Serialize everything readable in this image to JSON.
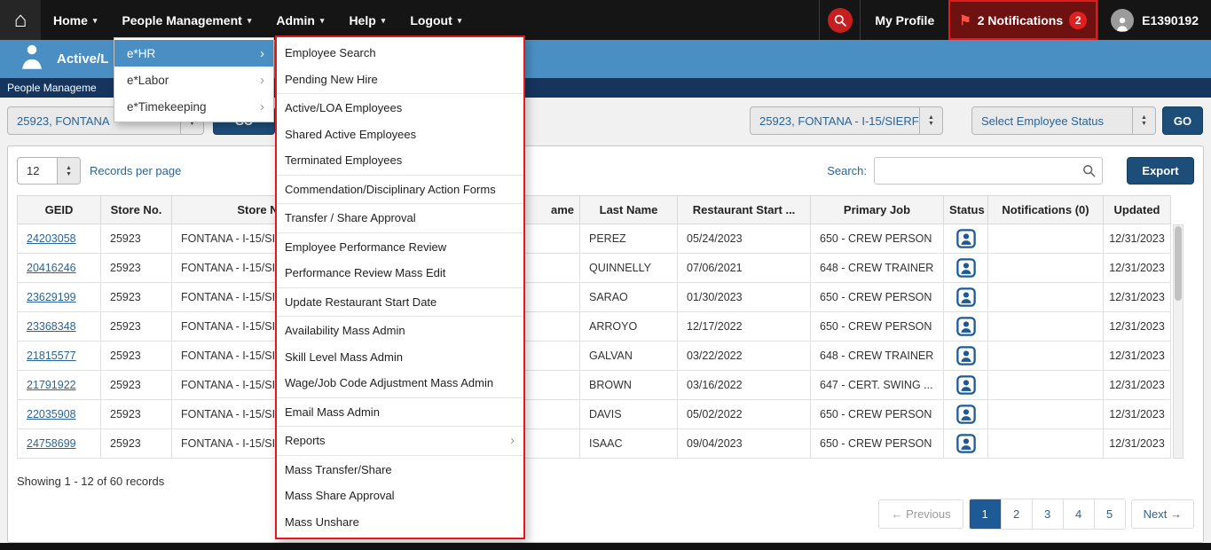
{
  "topnav": {
    "home_icon": "⌂",
    "items": [
      {
        "label": "Home"
      },
      {
        "label": "People Management"
      },
      {
        "label": "Admin"
      },
      {
        "label": "Help"
      },
      {
        "label": "Logout"
      }
    ],
    "my_profile": "My Profile",
    "notifications": {
      "label": "2 Notifications",
      "badge": "2"
    },
    "user_id": "E1390192"
  },
  "header": {
    "title": "Active/L",
    "breadcrumb": "People Manageme"
  },
  "menus": {
    "level1": [
      {
        "label": "e*HR",
        "active": true
      },
      {
        "label": "e*Labor",
        "active": false
      },
      {
        "label": "e*Timekeeping",
        "active": false
      }
    ],
    "submenu_groups": [
      [
        {
          "label": "Employee Search"
        },
        {
          "label": "Pending New Hire"
        }
      ],
      [
        {
          "label": "Active/LOA Employees"
        },
        {
          "label": "Shared Active Employees"
        },
        {
          "label": "Terminated Employees"
        }
      ],
      [
        {
          "label": "Commendation/Disciplinary Action Forms"
        }
      ],
      [
        {
          "label": "Transfer / Share Approval"
        }
      ],
      [
        {
          "label": "Employee Performance Review"
        },
        {
          "label": "Performance Review Mass Edit"
        }
      ],
      [
        {
          "label": "Update Restaurant Start Date"
        }
      ],
      [
        {
          "label": "Availability Mass Admin"
        },
        {
          "label": "Skill Level Mass Admin"
        },
        {
          "label": "Wage/Job Code Adjustment Mass Admin"
        }
      ],
      [
        {
          "label": "Email Mass Admin"
        }
      ],
      [
        {
          "label": "Reports",
          "has_submenu": true
        }
      ],
      [
        {
          "label": "Mass Transfer/Share"
        },
        {
          "label": "Mass Share Approval"
        },
        {
          "label": "Mass Unshare"
        }
      ]
    ]
  },
  "filters": {
    "left_store": "25923, FONTANA",
    "left_go": "GO",
    "right_store": "25923, FONTANA - I-15/SIERF",
    "status": "Select Employee Status",
    "go": "GO"
  },
  "toolbar": {
    "per_page": "12",
    "per_page_label": "Records per page",
    "search_label": "Search:",
    "export": "Export"
  },
  "table": {
    "headers": [
      "GEID",
      "Store No.",
      "Store Name",
      "ame",
      "Last Name",
      "Restaurant Start ...",
      "Primary Job",
      "Status",
      "Notifications (0)",
      "Updated"
    ],
    "rows": [
      {
        "geid": "24203058",
        "store_no": "25923",
        "store_name": "FONTANA - I-15/SI",
        "first_name": "",
        "last_name": "PEREZ",
        "start_date": "05/24/2023",
        "primary_job": "650 - CREW PERSON",
        "updated": "12/31/2023"
      },
      {
        "geid": "20416246",
        "store_no": "25923",
        "store_name": "FONTANA - I-15/SI",
        "first_name": "",
        "last_name": "QUINNELLY",
        "start_date": "07/06/2021",
        "primary_job": "648 - CREW TRAINER",
        "updated": "12/31/2023"
      },
      {
        "geid": "23629199",
        "store_no": "25923",
        "store_name": "FONTANA - I-15/SI",
        "first_name": "",
        "last_name": "SARAO",
        "start_date": "01/30/2023",
        "primary_job": "650 - CREW PERSON",
        "updated": "12/31/2023"
      },
      {
        "geid": "23368348",
        "store_no": "25923",
        "store_name": "FONTANA - I-15/SI",
        "first_name": "",
        "last_name": "ARROYO",
        "start_date": "12/17/2022",
        "primary_job": "650 - CREW PERSON",
        "updated": "12/31/2023"
      },
      {
        "geid": "21815577",
        "store_no": "25923",
        "store_name": "FONTANA - I-15/SI",
        "first_name": "",
        "last_name": "GALVAN",
        "start_date": "03/22/2022",
        "primary_job": "648 - CREW TRAINER",
        "updated": "12/31/2023"
      },
      {
        "geid": "21791922",
        "store_no": "25923",
        "store_name": "FONTANA - I-15/SI",
        "first_name": "",
        "last_name": "BROWN",
        "start_date": "03/16/2022",
        "primary_job": "647 - CERT. SWING ...",
        "updated": "12/31/2023"
      },
      {
        "geid": "22035908",
        "store_no": "25923",
        "store_name": "FONTANA - I-15/SI",
        "first_name": "",
        "last_name": "DAVIS",
        "start_date": "05/02/2022",
        "primary_job": "650 - CREW PERSON",
        "updated": "12/31/2023"
      },
      {
        "geid": "24758699",
        "store_no": "25923",
        "store_name": "FONTANA - I-15/SI",
        "first_name": "",
        "last_name": "ISAAC",
        "start_date": "09/04/2023",
        "primary_job": "650 - CREW PERSON",
        "updated": "12/31/2023"
      }
    ]
  },
  "footer": {
    "showing": "Showing 1 - 12 of 60 records",
    "pagination": {
      "prev": "← Previous",
      "pages": [
        "1",
        "2",
        "3",
        "4",
        "5"
      ],
      "active": "1",
      "next": "Next →"
    }
  },
  "colors": {
    "accent_blue": "#4a8fc4",
    "navy": "#1d4e79",
    "link_blue": "#2a6496",
    "alert_red": "#e01b1b"
  }
}
